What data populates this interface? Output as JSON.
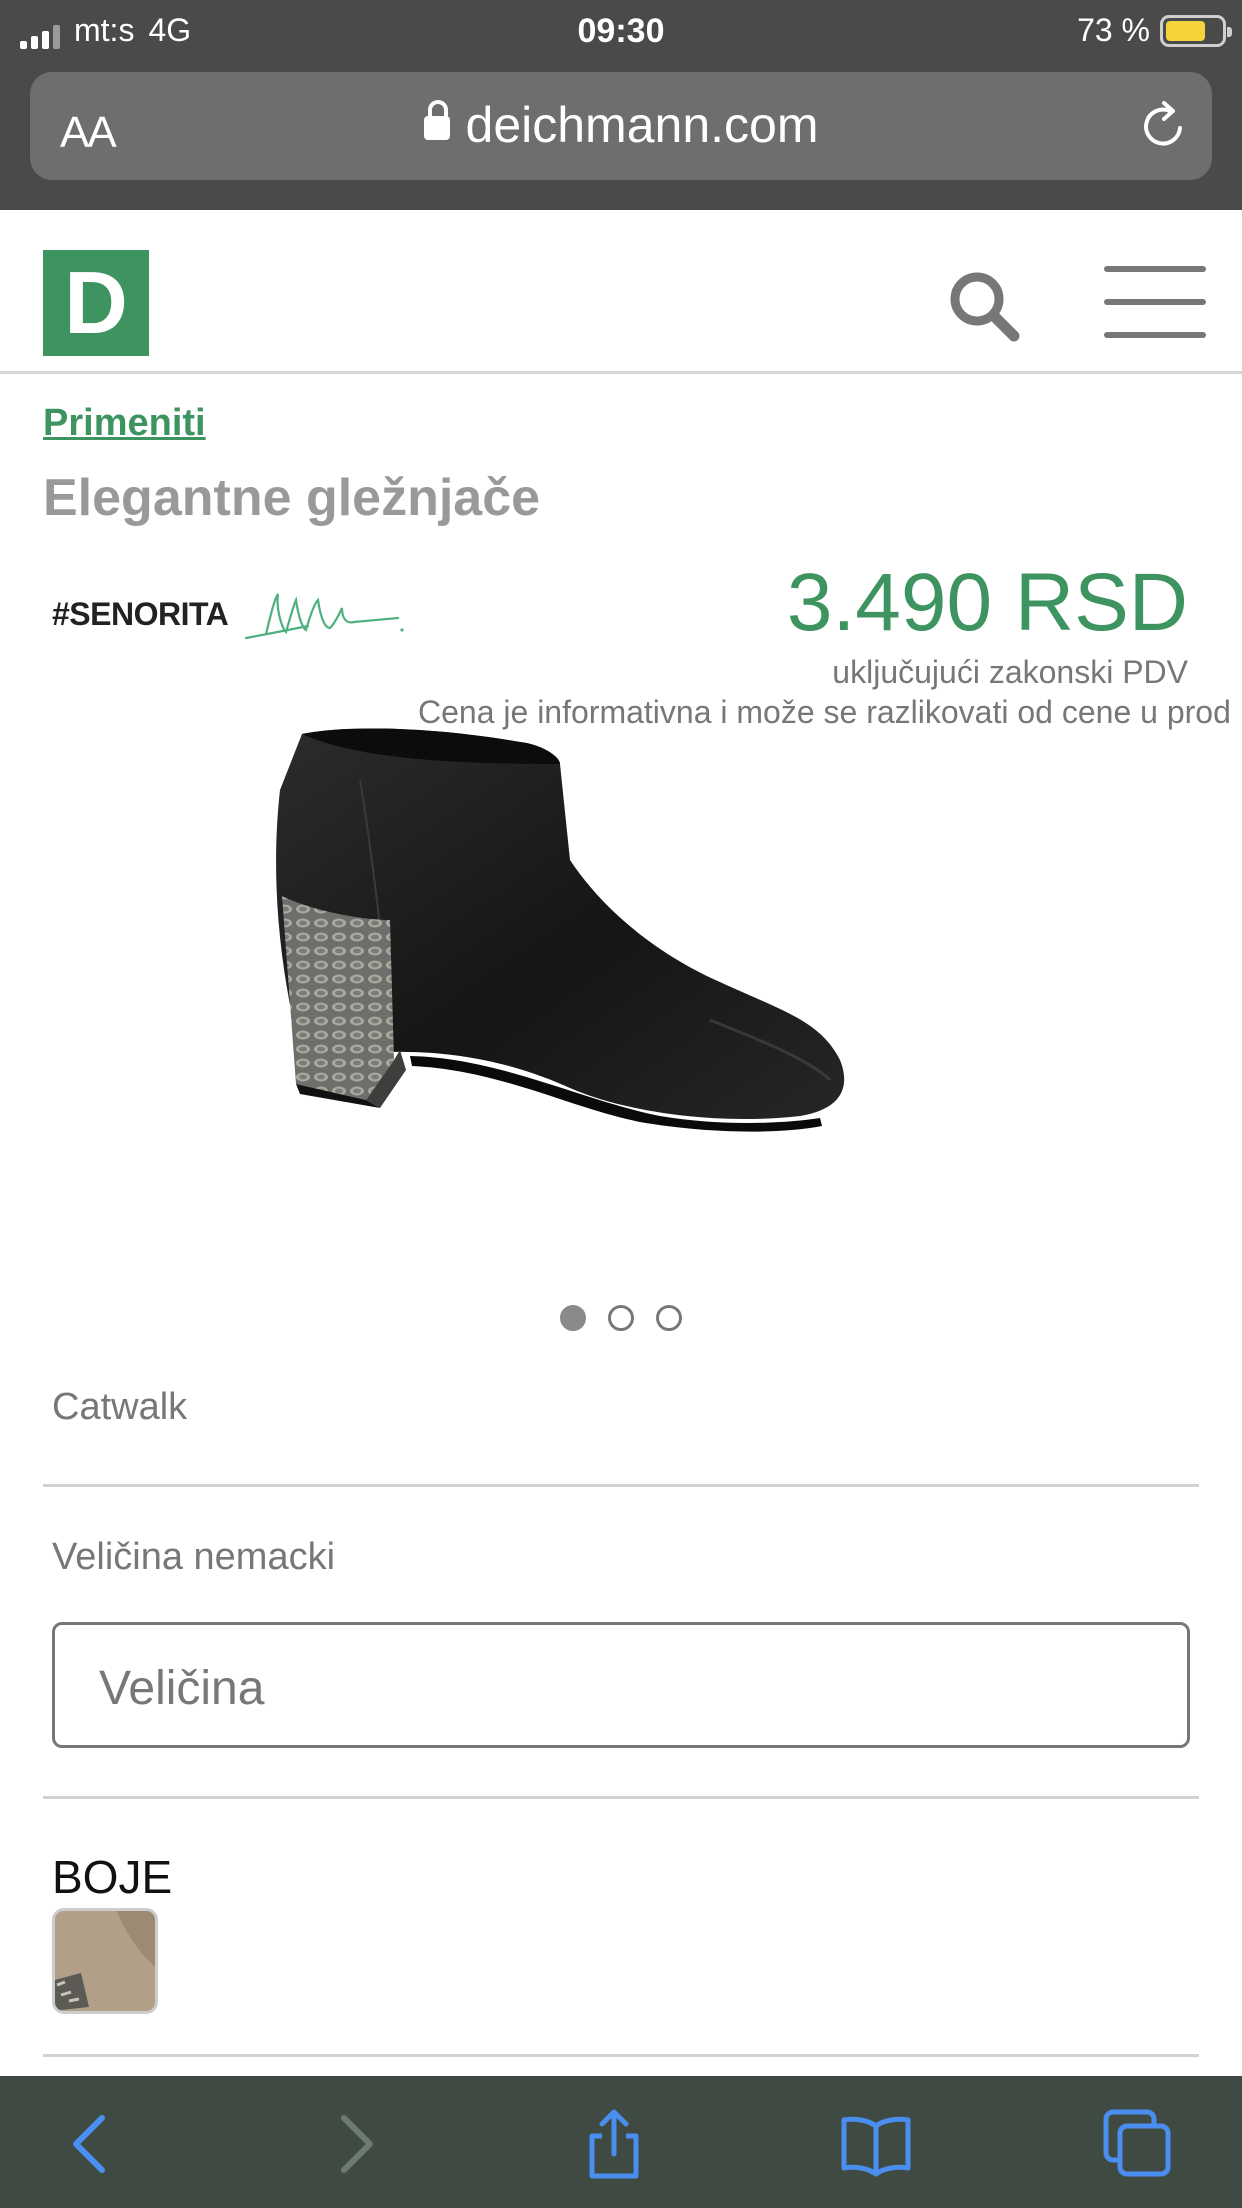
{
  "status_bar": {
    "carrier": "mt:s",
    "network": "4G",
    "time": "09:30",
    "battery_text": "73 %",
    "battery_level": 0.73
  },
  "browser": {
    "text_size_label": "AA",
    "domain": "deichmann.com"
  },
  "site": {
    "logo_letter": "D",
    "brand_color": "#3e9460"
  },
  "product": {
    "breadcrumb": "Primeniti",
    "title": "Elegantne gležnjače",
    "brand_tag": "#SENORITA",
    "price": "3.490 RSD",
    "vat_note": "uključujući zakonski PDV",
    "disclaimer": "Cena je informativna i može se razlikovati od cene u prod",
    "gallery": {
      "count": 3,
      "active_index": 0
    },
    "brand_name": "Catwalk",
    "size_label": "Veličina nemacki",
    "size_placeholder": "Veličina",
    "colors_label": "BOJE"
  },
  "toolbar": {
    "icons": [
      "back-icon",
      "forward-icon",
      "share-icon",
      "bookmarks-icon",
      "tabs-icon"
    ]
  }
}
